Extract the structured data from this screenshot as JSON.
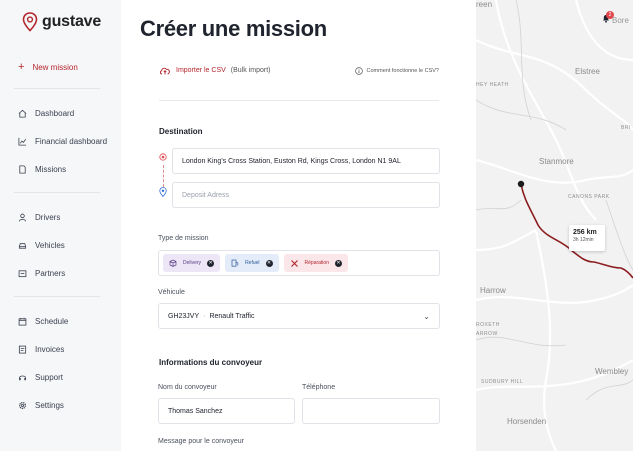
{
  "brand": {
    "name": "gustave",
    "accent": "#b3262d"
  },
  "nav": {
    "new_mission": "New mission",
    "items": [
      {
        "label": "Dashboard",
        "icon": "home-icon"
      },
      {
        "label": "Financial dashboard",
        "icon": "chart-line-icon"
      },
      {
        "label": "Missions",
        "icon": "document-icon"
      },
      {
        "label": "Drivers",
        "icon": "user-icon"
      },
      {
        "label": "Vehicles",
        "icon": "car-icon"
      },
      {
        "label": "Partners",
        "icon": "partner-icon"
      },
      {
        "label": "Schedule",
        "icon": "calendar-icon"
      },
      {
        "label": "Invoices",
        "icon": "invoice-icon"
      },
      {
        "label": "Support",
        "icon": "headset-icon"
      },
      {
        "label": "Settings",
        "icon": "gear-icon"
      }
    ]
  },
  "page": {
    "title": "Créer une mission",
    "import_csv": "Importer le CSV",
    "bulk_import": "(Bulk import)",
    "how_csv": "Comment fonctionne le CSV?"
  },
  "destination": {
    "title": "Destination",
    "origin_value": "London King's Cross Station, Euston Rd, Kings Cross, London N1 9AL",
    "deposit_placeholder": "Deposit Adress"
  },
  "mission_type": {
    "label": "Type de mission",
    "chips": [
      {
        "label": "Delivery",
        "icon": "box-icon"
      },
      {
        "label": "Refuel",
        "icon": "fuel-icon"
      },
      {
        "label": "Réparation",
        "icon": "wrench-icon"
      }
    ]
  },
  "vehicle": {
    "label": "Véhicule",
    "plate": "GH23JVY",
    "model": "Renault Traffic"
  },
  "driver": {
    "title": "Informations du convoyeur",
    "name_label": "Nom du convoyeur",
    "name_value": "Thomas Sanchez",
    "phone_label": "Téléphone",
    "phone_value": "",
    "message_label": "Message pour le convoyeur"
  },
  "map": {
    "labels": {
      "green": "reen",
      "bore": "Bore",
      "elstree": "Elstree",
      "hey_heath": "HEY HEATH",
      "stanmore": "Stanmore",
      "canons_park": "CANONS PARK",
      "harrow": "Harrow",
      "roxeth": "ROXETH",
      "arrow": "ARROW",
      "wembley": "Wembley",
      "sudbury_hill": "SUDBURY HILL",
      "horsenden": "Horsenden",
      "bri": "BRI"
    },
    "route_distance": "256 km",
    "route_time": "3h 12min",
    "notification_count": "2"
  }
}
